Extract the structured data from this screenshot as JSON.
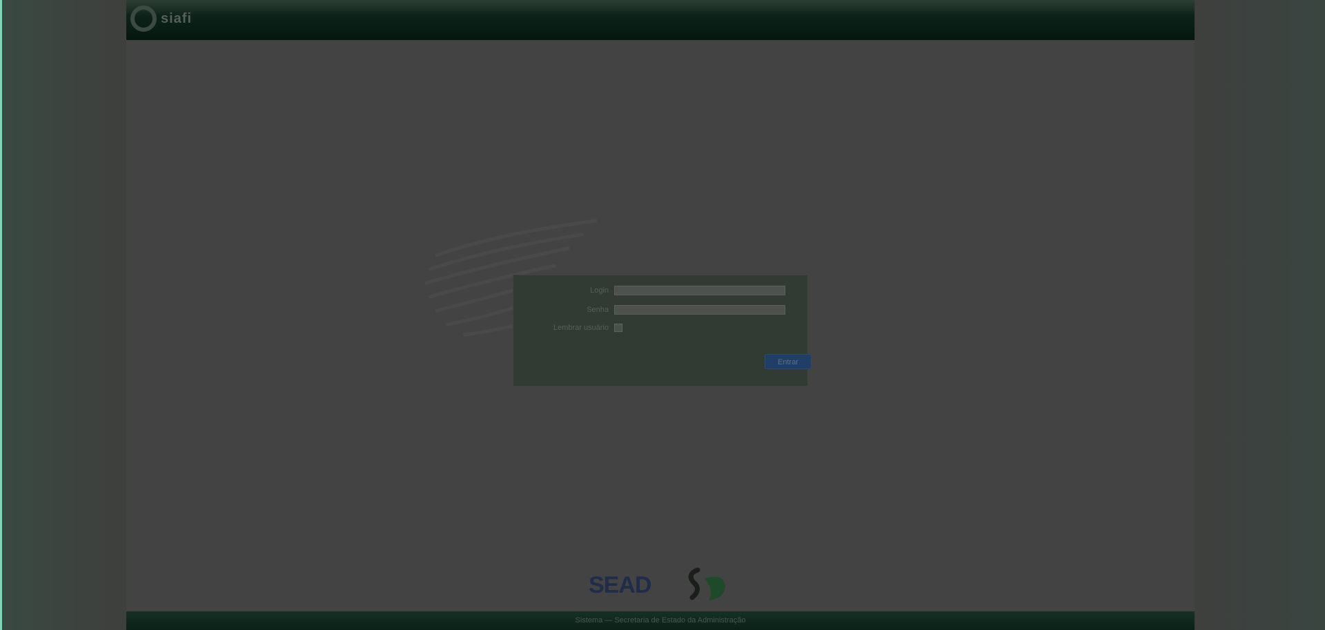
{
  "header": {
    "logo_text": "siafi"
  },
  "login": {
    "fields": [
      {
        "label": "Login",
        "value": "",
        "type": "text"
      },
      {
        "label": "Senha",
        "value": "",
        "type": "password"
      }
    ],
    "remember_label": "Lembrar usuário",
    "submit_label": "Entrar"
  },
  "footer": {
    "logo_seal_text": "SEAD",
    "bar_text": "Sistema — Secretaria de Estado da Administração"
  },
  "colors": {
    "header": "#04180f",
    "login_box": "#313b33",
    "button": "#1f3f66",
    "edge_accent": "#7fd6b2"
  }
}
